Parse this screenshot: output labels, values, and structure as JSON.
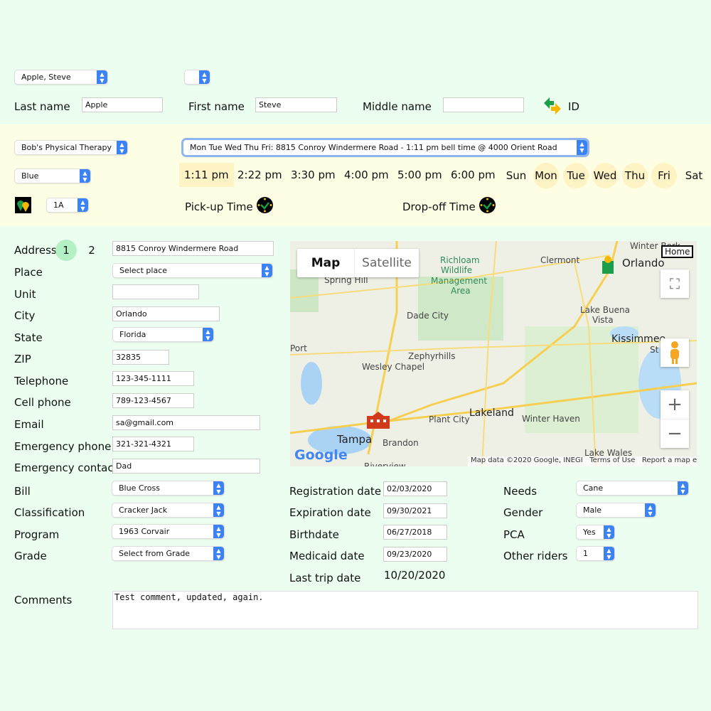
{
  "rider_select": "Apple, Steve",
  "small_select": "",
  "names": {
    "last_label": "Last name",
    "last_value": "Apple",
    "first_label": "First name",
    "first_value": "Steve",
    "middle_label": "Middle name",
    "middle_value": "",
    "id_label": "ID"
  },
  "trip": {
    "agency": "Bob's Physical Therapy",
    "route": "Mon Tue Wed Thu Fri: 8815 Conroy Windermere Road - 1:11 pm bell time @ 4000 Orient Road",
    "color": "Blue",
    "vehicle": "1A",
    "times": [
      {
        "label": "1:11 pm",
        "selected": true
      },
      {
        "label": "2:22 pm",
        "selected": false
      },
      {
        "label": "3:30 pm",
        "selected": false
      },
      {
        "label": "4:00 pm",
        "selected": false
      },
      {
        "label": "5:00 pm",
        "selected": false
      },
      {
        "label": "6:00 pm",
        "selected": false
      }
    ],
    "days": [
      {
        "label": "Sun",
        "selected": false
      },
      {
        "label": "Mon",
        "selected": true
      },
      {
        "label": "Tue",
        "selected": true
      },
      {
        "label": "Wed",
        "selected": true
      },
      {
        "label": "Thu",
        "selected": true
      },
      {
        "label": "Fri",
        "selected": true
      },
      {
        "label": "Sat",
        "selected": false
      }
    ],
    "pickup_label": "Pick-up Time",
    "dropoff_label": "Drop-off Time"
  },
  "address": {
    "label": "Address",
    "tab1": "1",
    "tab2": "2",
    "street": "8815 Conroy Windermere Road",
    "place_label": "Place",
    "place": "Select place",
    "unit_label": "Unit",
    "unit": "",
    "city_label": "City",
    "city": "Orlando",
    "state_label": "State",
    "state": "Florida",
    "zip_label": "ZIP",
    "zip": "32835",
    "tel_label": "Telephone",
    "tel": "123-345-1111",
    "cell_label": "Cell phone",
    "cell": "789-123-4567",
    "email_label": "Email",
    "email": "sa@gmail.com",
    "ephone_label": "Emergency phone",
    "ephone": "321-321-4321",
    "econtact_label": "Emergency contact",
    "econtact": "Dad"
  },
  "map": {
    "tab_map": "Map",
    "tab_satellite": "Satellite",
    "home": "Home",
    "attribution": "Map data ©2020 Google, INEGI",
    "terms": "Terms of Use",
    "report": "Report a map error",
    "logo": "Google",
    "places": [
      "Winter Bork",
      "Orlando",
      "Richloam",
      "Wildlife",
      "Management",
      "Area",
      "Clermont",
      "Spring Hill",
      "Lake Buena",
      "Vista",
      "Kissimmee",
      "Dade City",
      "Zephyrhills",
      "Wesley Chapel",
      "Port",
      "Lakeland",
      "Plant City",
      "Winter Haven",
      "Tampa",
      "Brandon",
      "Lake Wales",
      "Riverview",
      "St"
    ]
  },
  "billing": {
    "bill_label": "Bill",
    "bill": "Blue Cross",
    "class_label": "Classification",
    "class": "Cracker Jack",
    "program_label": "Program",
    "program": "1963 Corvair",
    "grade_label": "Grade",
    "grade": "Select from Grade"
  },
  "dates": {
    "reg_label": "Registration date",
    "reg": "02/03/2020",
    "exp_label": "Expiration date",
    "exp": "09/30/2021",
    "birth_label": "Birthdate",
    "birth": "06/27/2018",
    "medicaid_label": "Medicaid date",
    "medicaid": "09/23/2020",
    "last_label": "Last trip date",
    "last": "10/20/2020"
  },
  "extra": {
    "needs_label": "Needs",
    "needs": "Cane",
    "gender_label": "Gender",
    "gender": "Male",
    "pca_label": "PCA",
    "pca": "Yes",
    "riders_label": "Other riders",
    "riders": "1"
  },
  "comments": {
    "label": "Comments",
    "value": "Test comment, updated, again."
  }
}
